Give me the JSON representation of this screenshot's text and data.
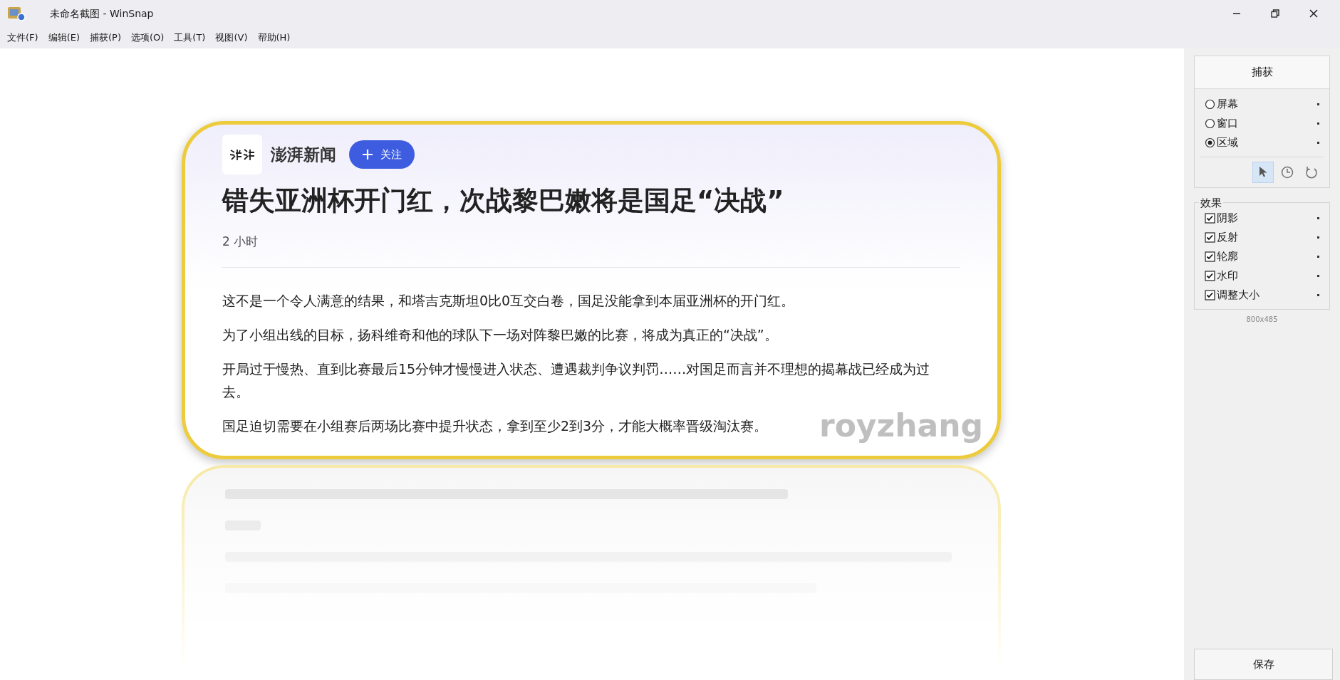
{
  "window": {
    "title": "未命名截图 - WinSnap"
  },
  "menu": [
    "文件(F)",
    "编辑(E)",
    "捕获(P)",
    "选项(O)",
    "工具(T)",
    "视图(V)",
    "帮助(H)"
  ],
  "preview": {
    "source": "澎湃新闻",
    "follow_button": "关注",
    "headline": "错失亚洲杯开门红，次战黎巴嫩将是国足“决战”",
    "time": "2 小时",
    "paragraphs": [
      "这不是一个令人满意的结果，和塔吉克斯坦0比0互交白卷，国足没能拿到本届亚洲杯的开门红。",
      "为了小组出线的目标，扬科维奇和他的球队下一场对阵黎巴嫩的比赛，将成为真正的“决战”。",
      "开局过于慢热、直到比赛最后15分钟才慢慢进入状态、遭遇裁判争议判罚……对国足而言并不理想的揭幕战已经成为过去。",
      "国足迫切需要在小组赛后两场比赛中提升状态，拿到至少2到3分，才能大概率晋级淘汰赛。"
    ],
    "watermark_text": "royzhang"
  },
  "panel": {
    "capture_button": "捕获",
    "capture_modes": [
      {
        "label": "屏幕",
        "selected": false
      },
      {
        "label": "窗口",
        "selected": false
      },
      {
        "label": "区域",
        "selected": true
      }
    ],
    "tools": [
      {
        "kind": "pointer",
        "selected": true
      },
      {
        "kind": "timer",
        "selected": false
      },
      {
        "kind": "repeat",
        "selected": false
      }
    ],
    "effects_title": "效果",
    "effects": [
      {
        "label": "阴影",
        "checked": true
      },
      {
        "label": "反射",
        "checked": true
      },
      {
        "label": "轮廓",
        "checked": true
      },
      {
        "label": "水印",
        "checked": true
      },
      {
        "label": "调整大小",
        "checked": true
      }
    ],
    "size": "800x485",
    "save_button": "保存"
  }
}
